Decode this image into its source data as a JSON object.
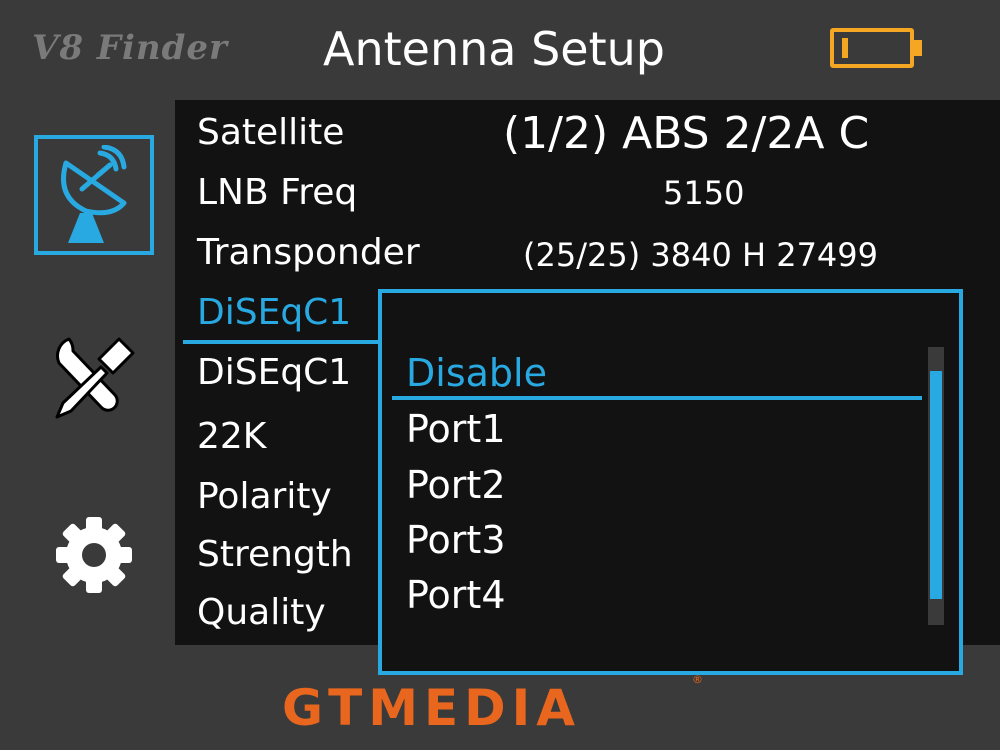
{
  "header": {
    "brand": "V8 Finder",
    "title": "Antenna Setup",
    "battery_icon": "battery-low-icon",
    "accent_color": "#f5a623"
  },
  "sidebar": {
    "items": [
      {
        "icon": "satellite-dish-icon",
        "active": true
      },
      {
        "icon": "tools-icon",
        "active": false
      },
      {
        "icon": "gear-icon",
        "active": false
      }
    ]
  },
  "settings": {
    "rows": [
      {
        "label": "Satellite",
        "value": "(1/2) ABS 2/2A C"
      },
      {
        "label": "LNB Freq",
        "value": "5150"
      },
      {
        "label": "Transponder",
        "value": "(25/25) 3840 H 27499"
      },
      {
        "label": "DiSEqC1"
      },
      {
        "label": "DiSEqC1"
      },
      {
        "label": "22K"
      },
      {
        "label": "Polarity"
      },
      {
        "label": "Strength"
      },
      {
        "label": "Quality"
      }
    ]
  },
  "popup": {
    "options": [
      "Disable",
      "Port1",
      "Port2",
      "Port3",
      "Port4"
    ],
    "selected": "Disable",
    "highlight_color": "#29a9e1"
  },
  "footer": {
    "logo": "GTMEDIA",
    "logo_mark": "®",
    "logo_color": "#e8661e"
  }
}
